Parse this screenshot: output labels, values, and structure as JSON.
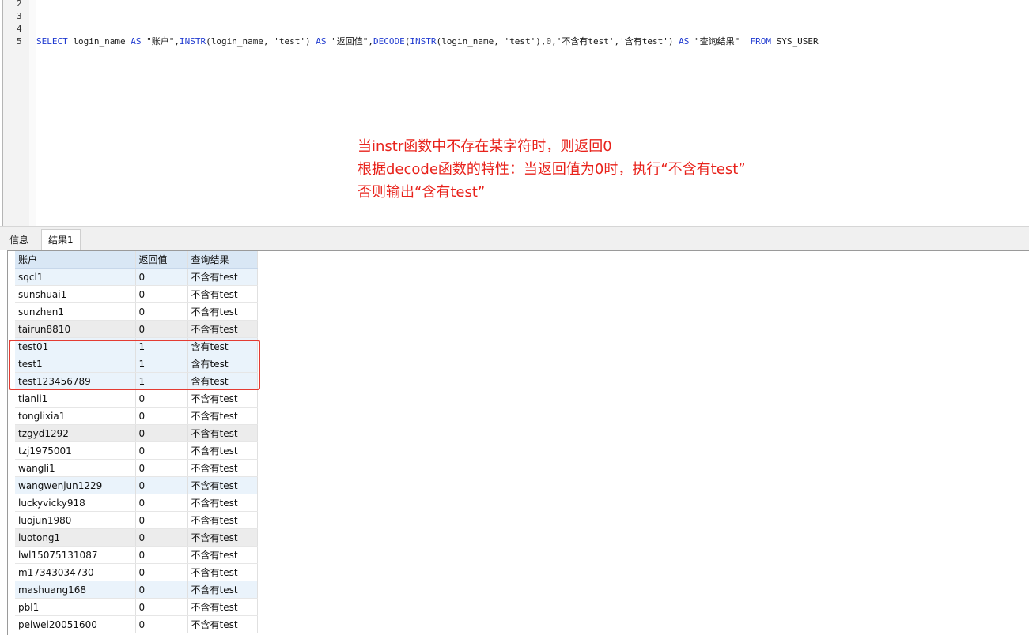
{
  "editor": {
    "line_numbers": [
      "2",
      "3",
      "4",
      "5"
    ],
    "sql": {
      "kw_select": "SELECT",
      "t1": " login_name ",
      "kw_as1": "AS",
      "a1": " \"账户\",",
      "fn_instr1": "INSTR",
      "t2": "(login_name, ",
      "s_test1": "'test'",
      "t3": ") ",
      "kw_as2": "AS",
      "a2": " \"返回值\",",
      "fn_decode": "DECODE",
      "t4": "(",
      "fn_instr2": "INSTR",
      "t5": "(login_name, ",
      "s_test2": "'test'",
      "t6": "),",
      "n0": "0",
      "t7": ",",
      "s_no": "'不含有test'",
      "t8": ",",
      "s_yes": "'含有test'",
      "t9": ") ",
      "kw_as3": "AS",
      "a3": " \"查询结果\"  ",
      "kw_from": "FROM",
      "t10": " SYS_USER"
    },
    "annotation": [
      "当instr函数中不存在某字符时，则返回0",
      "根据decode函数的特性：当返回值为0时，执行“不含有test”",
      "否则输出“含有test”"
    ]
  },
  "tabs": [
    {
      "label": "信息"
    },
    {
      "label": "结果1"
    }
  ],
  "grid": {
    "columns": [
      "账户",
      "返回值",
      "查询结果"
    ],
    "rows": [
      [
        "sqcl1",
        "0",
        "不含有test"
      ],
      [
        "sunshuai1",
        "0",
        "不含有test"
      ],
      [
        "sunzhen1",
        "0",
        "不含有test"
      ],
      [
        "tairun8810",
        "0",
        "不含有test"
      ],
      [
        "test01",
        "1",
        "含有test"
      ],
      [
        "test1",
        "1",
        "含有test"
      ],
      [
        "test123456789",
        "1",
        "含有test"
      ],
      [
        "tianli1",
        "0",
        "不含有test"
      ],
      [
        "tonglixia1",
        "0",
        "不含有test"
      ],
      [
        "tzgyd1292",
        "0",
        "不含有test"
      ],
      [
        "tzj1975001",
        "0",
        "不含有test"
      ],
      [
        "wangli1",
        "0",
        "不含有test"
      ],
      [
        "wangwenjun1229",
        "0",
        "不含有test"
      ],
      [
        "luckyvicky918",
        "0",
        "不含有test"
      ],
      [
        "luojun1980",
        "0",
        "不含有test"
      ],
      [
        "luotong1",
        "0",
        "不含有test"
      ],
      [
        "lwl15075131087",
        "0",
        "不含有test"
      ],
      [
        "m17343034730",
        "0",
        "不含有test"
      ],
      [
        "mashuang168",
        "0",
        "不含有test"
      ],
      [
        "pbl1",
        "0",
        "不含有test"
      ],
      [
        "peiwei20051600",
        "0",
        "不含有test"
      ]
    ]
  },
  "colors": {
    "annotation": "#e8221b",
    "keyword": "#1f3ad0",
    "highlight_border": "#e43b32",
    "header_bg": "#d9e7f5"
  }
}
